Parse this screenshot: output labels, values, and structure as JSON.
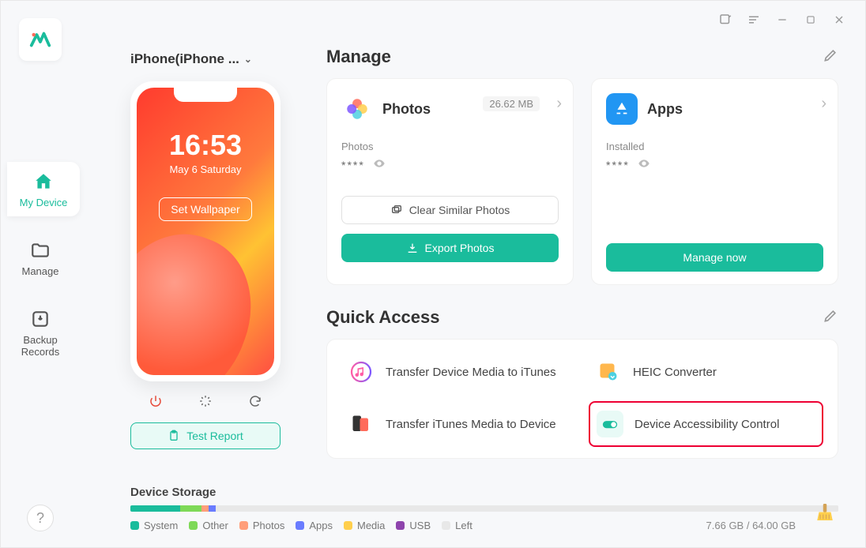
{
  "titlebar": {
    "tooltip_edit": "Feedback",
    "tooltip_menu": "Menu"
  },
  "sidebar": {
    "items": [
      {
        "label": "My Device"
      },
      {
        "label": "Manage"
      },
      {
        "label": "Backup Records"
      }
    ],
    "help": "?"
  },
  "device": {
    "name": "iPhone(iPhone ...",
    "time": "16:53",
    "date": "May 6 Saturday",
    "wallpaper_btn": "Set Wallpaper",
    "test_report": "Test Report"
  },
  "manage": {
    "title": "Manage",
    "photos": {
      "title": "Photos",
      "size": "26.62 MB",
      "sub": "Photos",
      "value": "****",
      "clear_btn": "Clear Similar Photos",
      "export_btn": "Export Photos"
    },
    "apps": {
      "title": "Apps",
      "sub": "Installed",
      "value": "****",
      "manage_btn": "Manage now"
    }
  },
  "quick": {
    "title": "Quick Access",
    "items": [
      {
        "label": "Transfer Device Media to iTunes"
      },
      {
        "label": "HEIC Converter"
      },
      {
        "label": "Transfer iTunes Media to Device"
      },
      {
        "label": "Device Accessibility Control"
      }
    ]
  },
  "storage": {
    "title": "Device Storage",
    "summary": "7.66 GB / 64.00 GB",
    "legend": [
      {
        "label": "System",
        "color": "#1abc9c",
        "pct": 7
      },
      {
        "label": "Other",
        "color": "#7ed957",
        "pct": 3
      },
      {
        "label": "Photos",
        "color": "#ff9e7a",
        "pct": 1
      },
      {
        "label": "Apps",
        "color": "#6a7cff",
        "pct": 1
      },
      {
        "label": "Media",
        "color": "#ffcf4d",
        "pct": 0
      },
      {
        "label": "USB",
        "color": "#8e44ad",
        "pct": 0
      },
      {
        "label": "Left",
        "color": "#e8e8e8",
        "pct": 88
      }
    ]
  }
}
